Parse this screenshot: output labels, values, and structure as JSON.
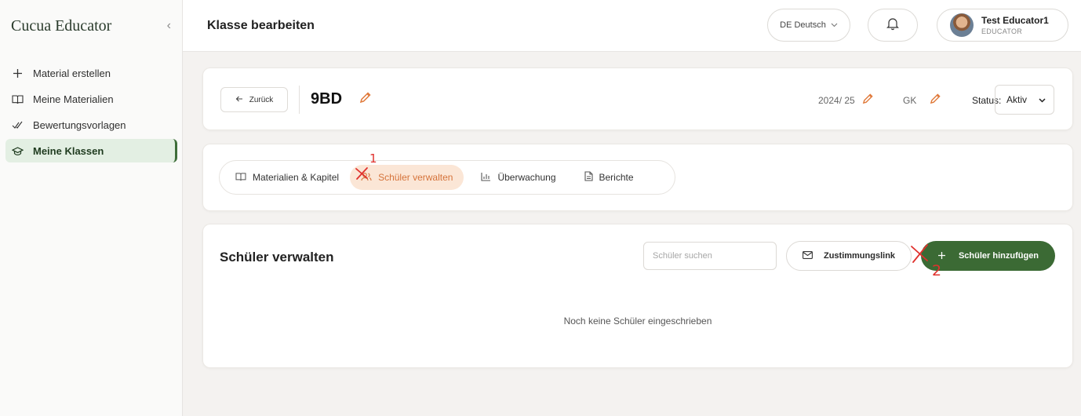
{
  "sidebar": {
    "brand": "Cucua Educator",
    "collapse_icon": "‹",
    "items": [
      {
        "label": "Material erstellen",
        "icon": "plus-icon"
      },
      {
        "label": "Meine Materialien",
        "icon": "book-icon"
      },
      {
        "label": "Bewertungsvorlagen",
        "icon": "double-check-icon"
      },
      {
        "label": "Meine Klassen",
        "icon": "graduation-cap-icon",
        "active": true
      }
    ]
  },
  "header": {
    "title": "Klasse bearbeiten",
    "language": "DE Deutsch",
    "user": {
      "name": "Test Educator1",
      "role": "EDUCATOR"
    }
  },
  "class_info": {
    "back_label": "Zurück",
    "name": "9BD",
    "year": "2024/ 25",
    "course": "GK",
    "status_label": "Status:",
    "status_value": "Aktiv"
  },
  "tabs": [
    {
      "label": "Materialien & Kapitel",
      "icon": "book-icon"
    },
    {
      "label": "Schüler verwalten",
      "icon": "users-icon",
      "active": true
    },
    {
      "label": "Überwachung",
      "icon": "bar-chart-icon"
    },
    {
      "label": "Berichte",
      "icon": "document-icon"
    }
  ],
  "students": {
    "title": "Schüler verwalten",
    "search_placeholder": "Schüler suchen",
    "consent_label": "Zustimmungslink",
    "add_label": "Schüler hinzufügen",
    "empty_text": "Noch keine Schüler eingeschrieben"
  },
  "annotations": {
    "mark1_number": "1",
    "mark2_number": "2",
    "color": "#e0312d"
  },
  "colors": {
    "accent_orange": "#d5733a",
    "primary_green": "#3b6a34",
    "active_nav_bg": "#e3efe3"
  }
}
